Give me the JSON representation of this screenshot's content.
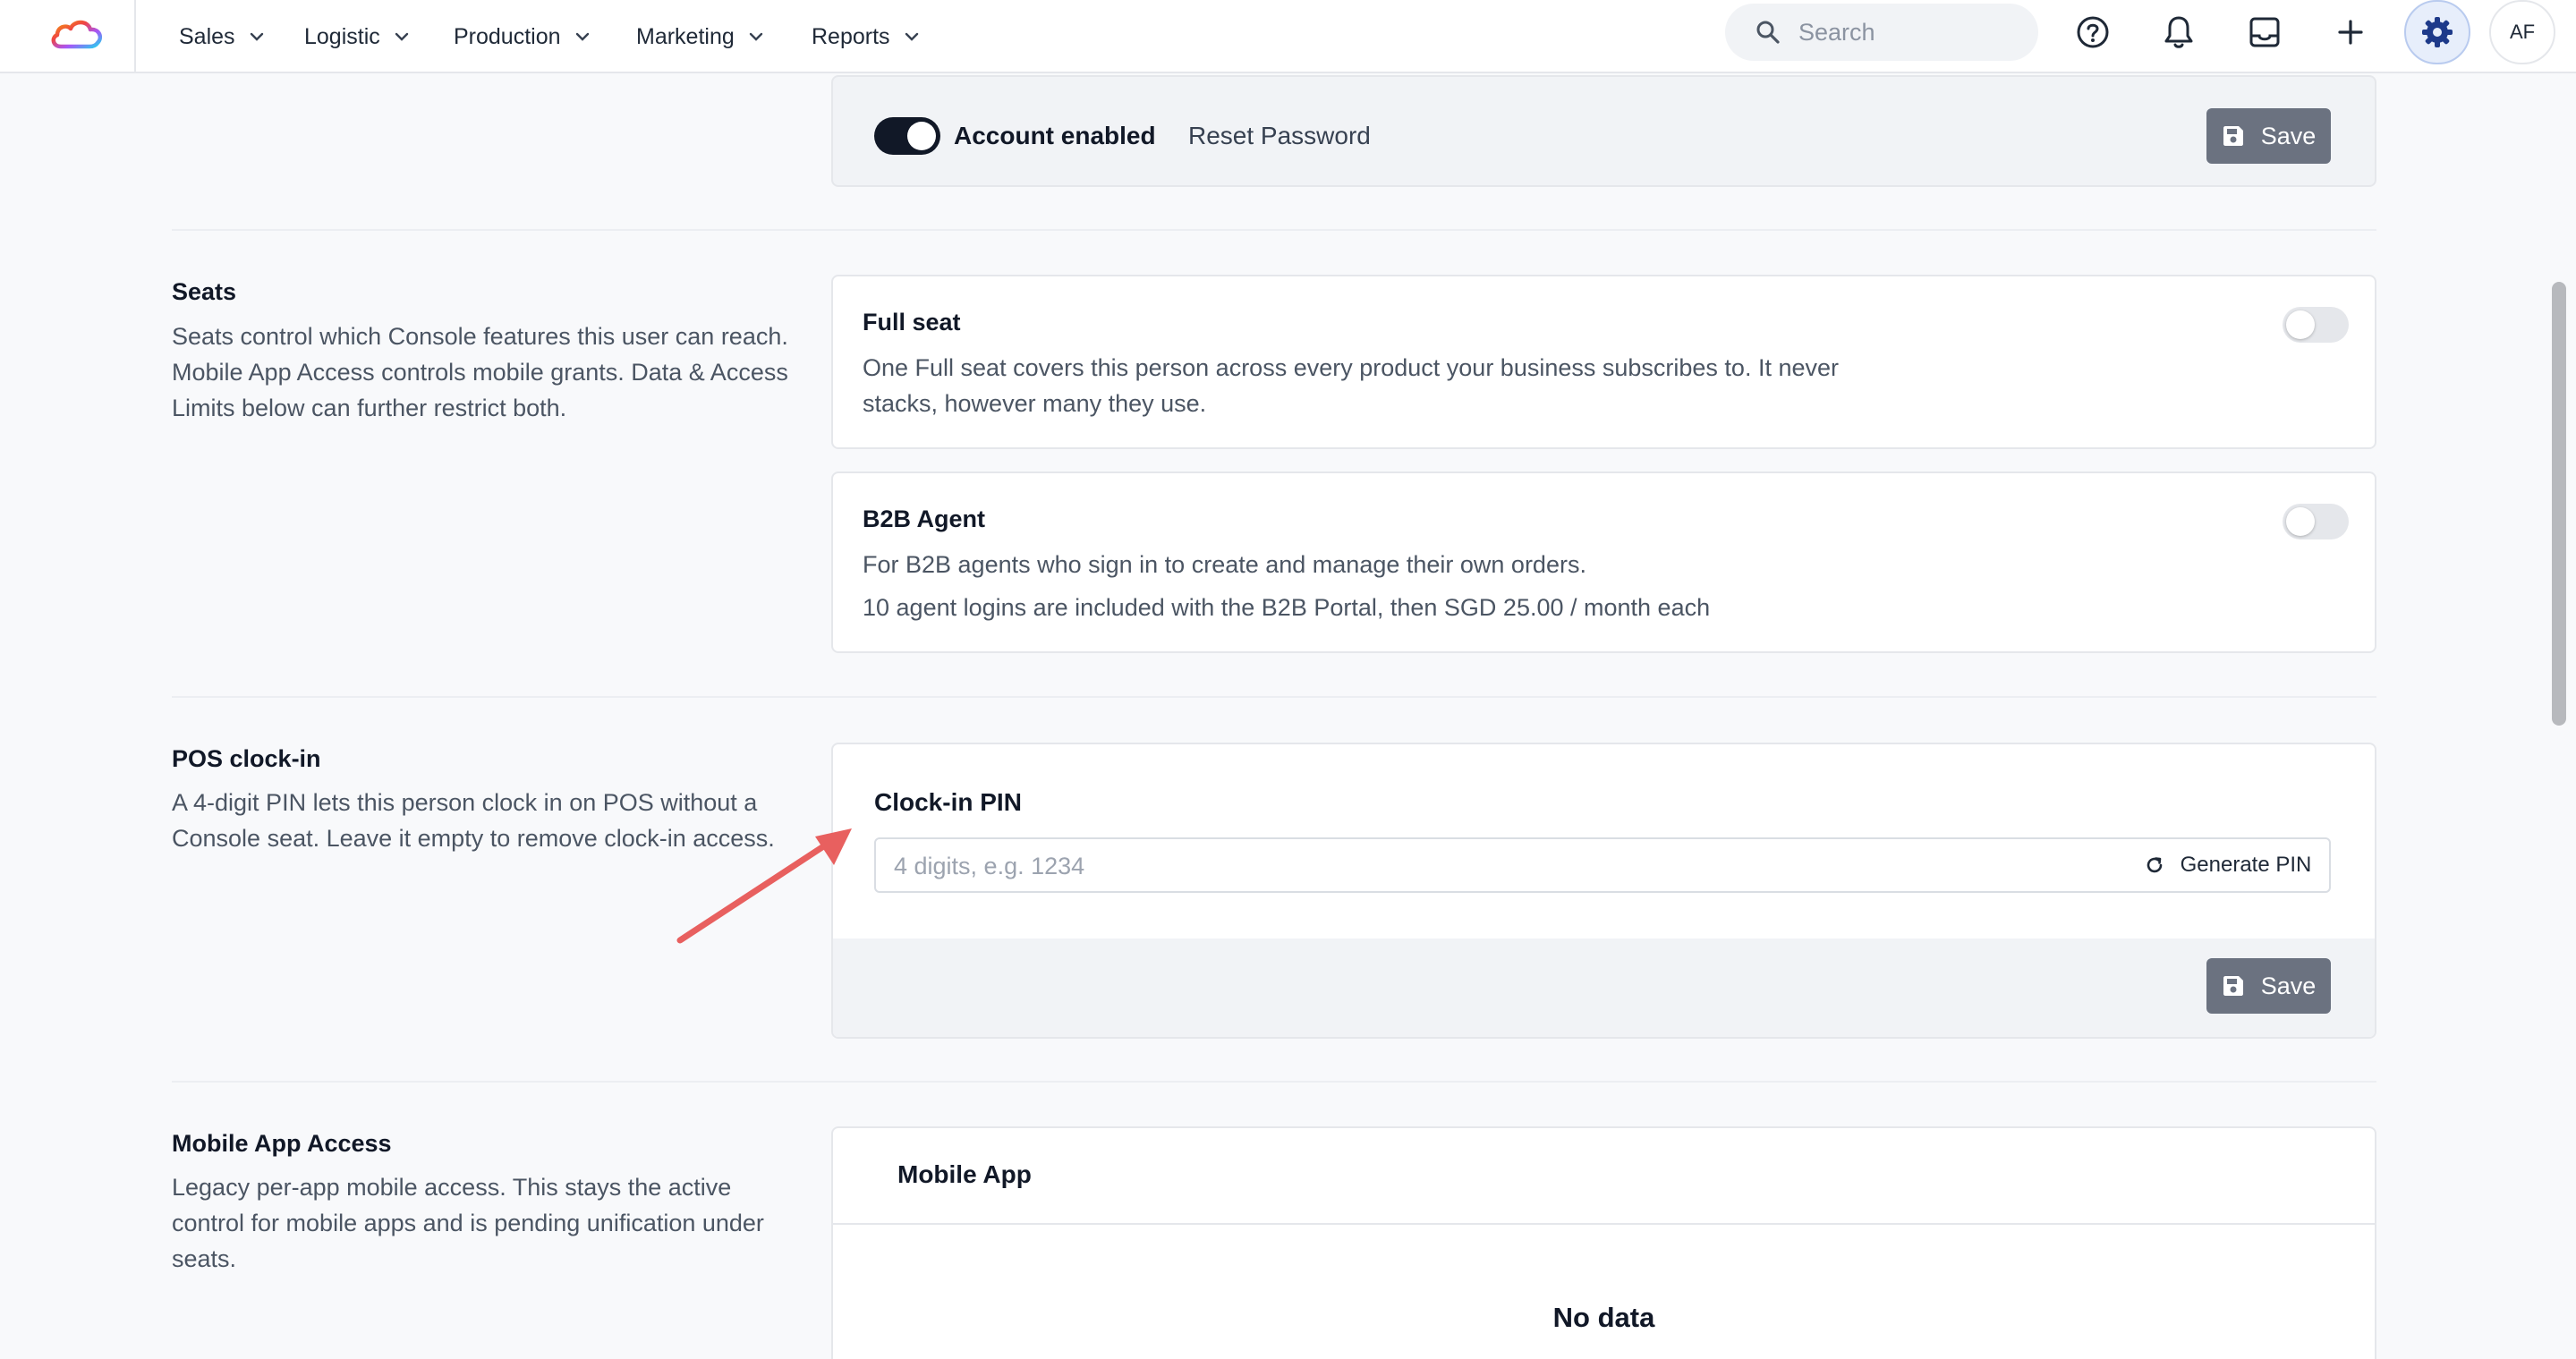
{
  "nav": {
    "items": [
      {
        "label": "Sales"
      },
      {
        "label": "Logistic"
      },
      {
        "label": "Production"
      },
      {
        "label": "Marketing"
      },
      {
        "label": "Reports"
      }
    ],
    "search_placeholder": "Search",
    "avatar_initials": "AF",
    "icons": [
      "cloud-logo-icon",
      "search-icon",
      "help-icon",
      "bell-icon",
      "inbox-icon",
      "plus-icon",
      "gear-icon"
    ]
  },
  "account": {
    "enabled_label": "Account enabled",
    "enabled": true,
    "reset_label": "Reset Password",
    "save_label": "Save"
  },
  "seats": {
    "title": "Seats",
    "description": "Seats control which Console features this user can reach. Mobile App Access controls mobile grants. Data & Access Limits below can further restrict both.",
    "full_seat": {
      "title": "Full seat",
      "text": "One Full seat covers this person across every product your business subscribes to. It never stacks, however many they use.",
      "enabled": false
    },
    "b2b_agent": {
      "title": "B2B Agent",
      "line1": "For B2B agents who sign in to create and manage their own orders.",
      "line2": "10 agent logins are included with the B2B Portal, then SGD 25.00 / month each",
      "enabled": false
    }
  },
  "pos": {
    "title": "POS clock-in",
    "description": "A 4-digit PIN lets this person clock in on POS without a Console seat. Leave it empty to remove clock-in access.",
    "pin_label": "Clock-in PIN",
    "pin_value": "",
    "pin_placeholder": "4 digits, e.g. 1234",
    "generate_label": "Generate PIN",
    "save_label": "Save"
  },
  "mobile": {
    "title": "Mobile App Access",
    "description": "Legacy per-app mobile access. This stays the active control for mobile apps and is pending unification under seats.",
    "table_header": "Mobile App",
    "empty_text": "No data"
  },
  "colors": {
    "accent": "#111827",
    "annotation_arrow": "#e8605f",
    "save_button": "#6b7280",
    "page_bg": "#f8f9fb"
  }
}
